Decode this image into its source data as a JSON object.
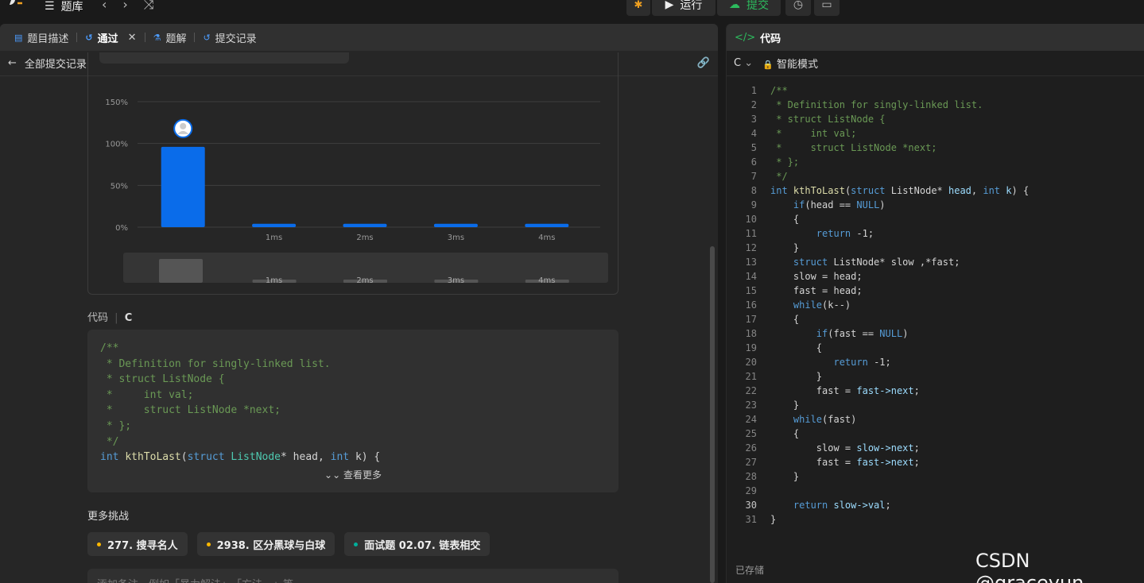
{
  "topbar": {
    "problem_bank": "题库",
    "run": "运行",
    "submit": "提交"
  },
  "left": {
    "tabs": [
      {
        "label": "题目描述"
      },
      {
        "label": "通过"
      },
      {
        "label": "题解"
      },
      {
        "label": "提交记录"
      }
    ],
    "back_label": "全部提交记录",
    "code_section": {
      "title": "代码",
      "lang": "C"
    },
    "code_preview": [
      "/**",
      " * Definition for singly-linked list.",
      " * struct ListNode {",
      " *     int val;",
      " *     struct ListNode *next;",
      " * };",
      " */",
      "int kthToLast(struct ListNode* head, int k) {"
    ],
    "see_more": "查看更多",
    "more_challenges": {
      "title": "更多挑战",
      "items": [
        {
          "label": "277. 搜寻名人",
          "color": "#ffb800"
        },
        {
          "label": "2938. 区分黑球与白球",
          "color": "#ffb800"
        },
        {
          "label": "面试题 02.07. 链表相交",
          "color": "#00af9b"
        }
      ]
    },
    "note_placeholder": "添加备注，例如「暴力解法」、「方法一」等"
  },
  "chart_data": {
    "type": "bar",
    "y_ticks": [
      "150%",
      "100%",
      "50%",
      "0%"
    ],
    "ylim": [
      0,
      150
    ],
    "categories": [
      "",
      "1ms",
      "2ms",
      "3ms",
      "4ms"
    ],
    "values": [
      96,
      4,
      4,
      4,
      4
    ],
    "navigator_labels": [
      "1ms",
      "2ms",
      "3ms",
      "4ms"
    ],
    "bar_color": "#0a6cea",
    "highlight_index": 0
  },
  "right": {
    "title": "代码",
    "lang": "C",
    "mode": "智能模式",
    "saved": "已存储",
    "current_line": 30,
    "code_lines": [
      [
        [
          "/**",
          "cm"
        ]
      ],
      [
        [
          " * Definition for singly-linked list.",
          "cm"
        ]
      ],
      [
        [
          " * struct ListNode {",
          "cm"
        ]
      ],
      [
        [
          " *     int val;",
          "cm"
        ]
      ],
      [
        [
          " *     struct ListNode *next;",
          "cm"
        ]
      ],
      [
        [
          " * };",
          "cm"
        ]
      ],
      [
        [
          " */",
          "cm"
        ]
      ],
      [
        [
          "int ",
          "kw"
        ],
        [
          "kthToLast",
          "fn"
        ],
        [
          "(",
          "pl"
        ],
        [
          "struct ",
          "kw"
        ],
        [
          "ListNode",
          "pl"
        ],
        [
          "* ",
          "pl"
        ],
        [
          "head",
          "var"
        ],
        [
          ", ",
          "pl"
        ],
        [
          "int ",
          "kw"
        ],
        [
          "k",
          "var"
        ],
        [
          ") {",
          "pl"
        ]
      ],
      [
        [
          "    ",
          "pl"
        ],
        [
          "if",
          "ctl"
        ],
        [
          "(head == ",
          "pl"
        ],
        [
          "NULL",
          "kw"
        ],
        [
          ")",
          "pl"
        ]
      ],
      [
        [
          "    {",
          "pl"
        ]
      ],
      [
        [
          "        ",
          "pl"
        ],
        [
          "return ",
          "ctl"
        ],
        [
          "-1;",
          "pl"
        ]
      ],
      [
        [
          "    }",
          "pl"
        ]
      ],
      [
        [
          "    ",
          "pl"
        ],
        [
          "struct ",
          "kw"
        ],
        [
          "ListNode* slow ,*fast;",
          "pl"
        ]
      ],
      [
        [
          "    slow = head;",
          "pl"
        ]
      ],
      [
        [
          "    fast = head;",
          "pl"
        ]
      ],
      [
        [
          "    ",
          "pl"
        ],
        [
          "while",
          "ctl"
        ],
        [
          "(k--)",
          "pl"
        ]
      ],
      [
        [
          "    {",
          "pl"
        ]
      ],
      [
        [
          "        ",
          "pl"
        ],
        [
          "if",
          "ctl"
        ],
        [
          "(fast == ",
          "pl"
        ],
        [
          "NULL",
          "kw"
        ],
        [
          ")",
          "pl"
        ]
      ],
      [
        [
          "        {",
          "pl"
        ]
      ],
      [
        [
          "           ",
          "pl"
        ],
        [
          "return ",
          "ctl"
        ],
        [
          "-1;",
          "pl"
        ]
      ],
      [
        [
          "        }",
          "pl"
        ]
      ],
      [
        [
          "        fast = ",
          "pl"
        ],
        [
          "fast->next",
          "var"
        ],
        [
          ";",
          "pl"
        ]
      ],
      [
        [
          "    }",
          "pl"
        ]
      ],
      [
        [
          "    ",
          "pl"
        ],
        [
          "while",
          "ctl"
        ],
        [
          "(fast)",
          "pl"
        ]
      ],
      [
        [
          "    {",
          "pl"
        ]
      ],
      [
        [
          "        slow = ",
          "pl"
        ],
        [
          "slow->next",
          "var"
        ],
        [
          ";",
          "pl"
        ]
      ],
      [
        [
          "        fast = ",
          "pl"
        ],
        [
          "fast->next",
          "var"
        ],
        [
          ";",
          "pl"
        ]
      ],
      [
        [
          "    }",
          "pl"
        ]
      ],
      [
        [
          "",
          "pl"
        ]
      ],
      [
        [
          "    ",
          "pl"
        ],
        [
          "return ",
          "ctl"
        ],
        [
          "slow->val",
          "var"
        ],
        [
          ";",
          "pl"
        ]
      ],
      [
        [
          "}",
          "pl"
        ]
      ]
    ]
  },
  "watermark": "CSDN @graceyun"
}
